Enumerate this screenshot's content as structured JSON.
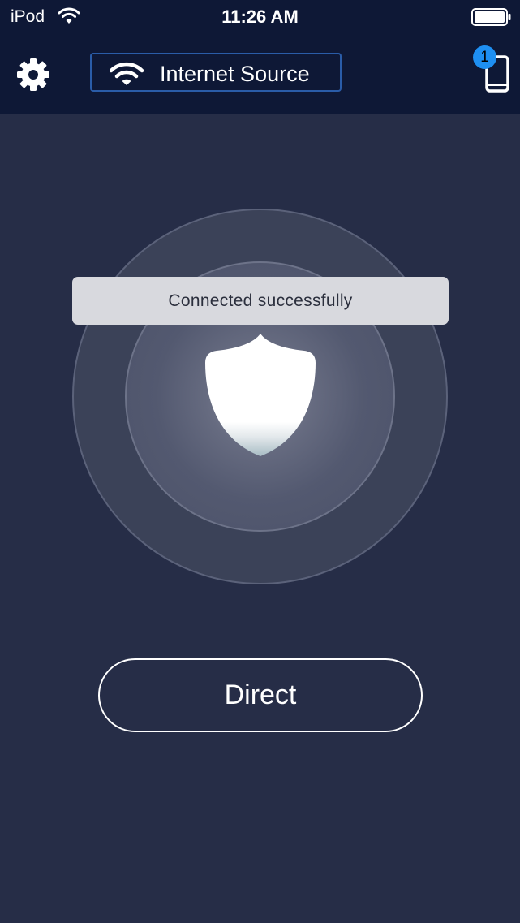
{
  "status_bar": {
    "carrier": "iPod",
    "time": "11:26 AM",
    "wifi_icon": "wifi-icon",
    "battery_icon": "battery-icon"
  },
  "header": {
    "settings_icon": "gear-icon",
    "source_button_label": "Internet Source",
    "source_icon": "wifi-icon",
    "device_icon": "phone-icon",
    "device_badge_count": "1"
  },
  "main": {
    "toast_message": "Connected successfully",
    "shield_icon": "shield-icon",
    "mode_button_label": "Direct"
  },
  "colors": {
    "background": "#262d47",
    "topbar": "#0e1836",
    "source_border": "#2a5ca8",
    "badge": "#1e8ff2",
    "toast": "#d8d9de"
  }
}
